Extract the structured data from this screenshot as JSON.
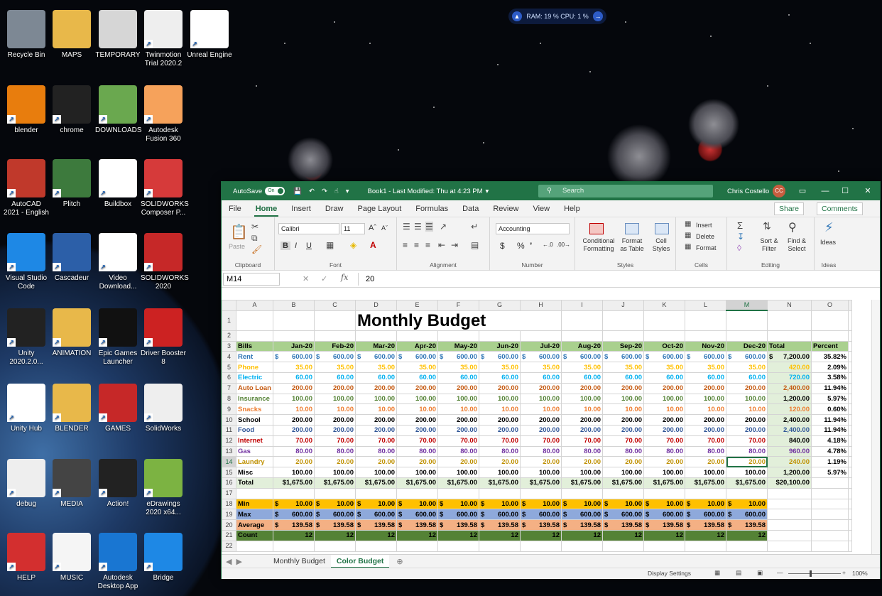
{
  "resource_monitor": {
    "text": "RAM: 19 %  CPU: 1 %"
  },
  "desktop_icons": [
    {
      "label": "Recycle Bin"
    },
    {
      "label": "MAPS"
    },
    {
      "label": "TEMPORARY"
    },
    {
      "label": "Twinmotion Trial 2020.2"
    },
    {
      "label": "Unreal Engine"
    },
    {
      "label": "blender"
    },
    {
      "label": "chrome"
    },
    {
      "label": "DOWNLOADS"
    },
    {
      "label": "Autodesk Fusion 360"
    },
    {
      "label": "AutoCAD 2021 - English"
    },
    {
      "label": "Plitch"
    },
    {
      "label": "Buildbox"
    },
    {
      "label": "SOLIDWORKS Composer P..."
    },
    {
      "label": "Visual Studio Code"
    },
    {
      "label": "Cascadeur"
    },
    {
      "label": "Video Download..."
    },
    {
      "label": "SOLIDWORKS 2020"
    },
    {
      "label": "Unity 2020.2.0..."
    },
    {
      "label": "ANIMATION"
    },
    {
      "label": "Epic Games Launcher"
    },
    {
      "label": "Driver Booster 8"
    },
    {
      "label": "Unity Hub"
    },
    {
      "label": "BLENDER"
    },
    {
      "label": "GAMES"
    },
    {
      "label": "SolidWorks"
    },
    {
      "label": "debug"
    },
    {
      "label": "MEDIA"
    },
    {
      "label": "Action!"
    },
    {
      "label": "eDrawings 2020 x64..."
    },
    {
      "label": "HELP"
    },
    {
      "label": "MUSIC"
    },
    {
      "label": "Autodesk Desktop App"
    },
    {
      "label": "Bridge"
    }
  ],
  "excel": {
    "autosave": "AutoSave",
    "autosave_state": "On",
    "doc_title": "Book1 - Last Modified: Thu at 4:23 PM",
    "search_placeholder": "Search",
    "user": "Chris Costello",
    "user_initials": "CC",
    "menus": [
      "File",
      "Home",
      "Insert",
      "Draw",
      "Page Layout",
      "Formulas",
      "Data",
      "Review",
      "View",
      "Help"
    ],
    "share": "Share",
    "comments": "Comments",
    "ribbon": {
      "clipboard": "Clipboard",
      "paste": "Paste",
      "font": "Font",
      "font_name": "Calibri",
      "font_size": "11",
      "bold": "B",
      "italic": "I",
      "underline": "U",
      "alignment": "Alignment",
      "number": "Number",
      "number_format": "Accounting",
      "styles": "Styles",
      "conditional": "Conditional Formatting",
      "format_table": "Format as Table",
      "cell_styles": "Cell Styles",
      "cells": "Cells",
      "insert": "Insert",
      "delete": "Delete",
      "format": "Format",
      "editing": "Editing",
      "sort": "Sort & Filter",
      "find": "Find & Select",
      "ideas": "Ideas",
      "ideas_group": "Ideas"
    },
    "name_box": "M14",
    "formula_value": "20",
    "columns": [
      "A",
      "B",
      "C",
      "D",
      "E",
      "F",
      "G",
      "H",
      "I",
      "J",
      "K",
      "L",
      "M",
      "N",
      "O"
    ],
    "title": "Monthly Budget",
    "headers": [
      "Bills",
      "Jan-20",
      "Feb-20",
      "Mar-20",
      "Apr-20",
      "May-20",
      "Jun-20",
      "Jul-20",
      "Aug-20",
      "Sep-20",
      "Oct-20",
      "Nov-20",
      "Dec-20",
      "Total",
      "Percent"
    ],
    "bills": [
      {
        "name": "Rent",
        "color": "#2e75b6",
        "monthly": "600.00",
        "acc": true,
        "total": "7,200.00",
        "percent": "35.82%"
      },
      {
        "name": "Phone",
        "color": "#ffc000",
        "monthly": "35.00",
        "acc": false,
        "total": "420.00",
        "percent": "2.09%"
      },
      {
        "name": "Electric",
        "color": "#00b0f0",
        "monthly": "60.00",
        "acc": false,
        "total": "720.00",
        "percent": "3.58%"
      },
      {
        "name": "Auto Loan",
        "color": "#c55a11",
        "monthly": "200.00",
        "acc": false,
        "total": "2,400.00",
        "percent": "11.94%"
      },
      {
        "name": "Insurance",
        "color": "#548235",
        "monthly": "100.00",
        "acc": false,
        "total": "1,200.00",
        "percent": "5.97%"
      },
      {
        "name": "Snacks",
        "color": "#ed7d31",
        "monthly": "10.00",
        "acc": false,
        "total": "120.00",
        "percent": "0.60%"
      },
      {
        "name": "School",
        "color": "#000000",
        "monthly": "200.00",
        "acc": false,
        "total": "2,400.00",
        "percent": "11.94%"
      },
      {
        "name": "Food",
        "color": "#2f5597",
        "monthly": "200.00",
        "acc": false,
        "total": "2,400.00",
        "percent": "11.94%"
      },
      {
        "name": "Internet",
        "color": "#c00000",
        "monthly": "70.00",
        "acc": false,
        "total": "840.00",
        "percent": "4.18%"
      },
      {
        "name": "Gas",
        "color": "#7030a0",
        "monthly": "80.00",
        "acc": false,
        "total": "960.00",
        "percent": "4.78%"
      },
      {
        "name": "Laundry",
        "color": "#bf9000",
        "monthly": "20.00",
        "acc": false,
        "total": "240.00",
        "percent": "1.19%"
      },
      {
        "name": "Misc",
        "color": "#000000",
        "monthly": "100.00",
        "acc": false,
        "total": "1,200.00",
        "percent": "5.97%"
      }
    ],
    "total_row": {
      "label": "Total",
      "monthly": "$1,675.00",
      "total": "$20,100.00"
    },
    "stats": [
      {
        "label": "Min",
        "value": "10.00",
        "cls": "r-min"
      },
      {
        "label": "Max",
        "value": "600.00",
        "cls": "r-max"
      },
      {
        "label": "Average",
        "value": "139.58",
        "cls": "r-avg"
      },
      {
        "label": "Count",
        "value": "12",
        "cls": "r-cnt"
      }
    ],
    "sheets": [
      "Monthly Budget",
      "Color Budget"
    ],
    "active_sheet": "Color Budget",
    "status": {
      "display_settings": "Display Settings",
      "zoom": "100%"
    }
  }
}
